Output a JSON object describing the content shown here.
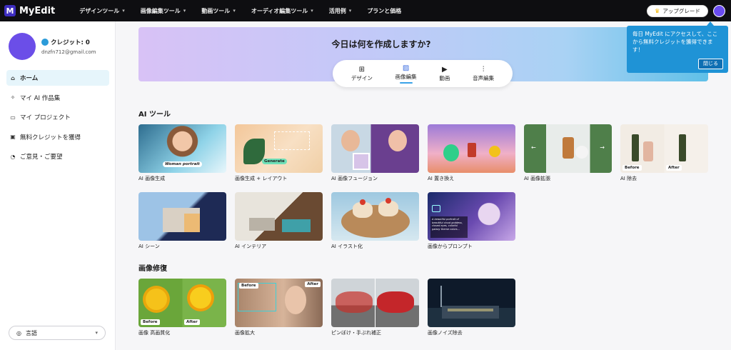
{
  "brand": {
    "name": "MyEdit",
    "logo_letter": "M"
  },
  "nav": [
    {
      "label": "デザインツール"
    },
    {
      "label": "画像編集ツール"
    },
    {
      "label": "動画ツール"
    },
    {
      "label": "オーディオ編集ツール"
    },
    {
      "label": "活用例"
    },
    {
      "label": "プランと価格"
    }
  ],
  "upgrade_label": "アップグレード",
  "profile": {
    "credit": "クレジット: 0",
    "email": "dnzfn712@gmail.com"
  },
  "menu": [
    {
      "label": "ホーム",
      "icon": "home-icon",
      "glyph": "⌂",
      "active": true
    },
    {
      "label": "マイ AI 作品集",
      "icon": "sparkle-icon",
      "glyph": "✧",
      "active": false
    },
    {
      "label": "マイ プロジェクト",
      "icon": "folder-icon",
      "glyph": "▭",
      "active": false
    },
    {
      "label": "無料クレジットを獲得",
      "icon": "gift-icon",
      "glyph": "▣",
      "active": false
    },
    {
      "label": "ご意見・ご要望",
      "icon": "feedback-icon",
      "glyph": "◔",
      "active": false
    }
  ],
  "language": {
    "label": "言語"
  },
  "hero": {
    "title": "今日は何を作成しますか?"
  },
  "create_tabs": [
    {
      "label": "デザイン",
      "icon": "design-icon",
      "glyph": "⊞",
      "active": false
    },
    {
      "label": "画像編集",
      "icon": "image-edit-icon",
      "glyph": "▨",
      "active": true
    },
    {
      "label": "動画",
      "icon": "video-icon",
      "glyph": "▶",
      "active": false
    },
    {
      "label": "音声編集",
      "icon": "audio-wave-icon",
      "glyph": "⫶",
      "active": false
    }
  ],
  "tooltip": {
    "text": "毎日 MyEdit にアクセスして、ここから無料クレジットを獲得できます！",
    "close_label": "閉じる"
  },
  "sections": {
    "ai_tools": {
      "title": "AI ツール",
      "cards": [
        {
          "label": "AI 画像生成",
          "overlay": "Woman portrait"
        },
        {
          "label": "画像生成 + レイアウト",
          "overlay": "Generate"
        },
        {
          "label": "AI 画像フュージョン"
        },
        {
          "label": "AI 置き換え"
        },
        {
          "label": "AI 画像拡張"
        },
        {
          "label": "AI 除去",
          "tag_left": "Before",
          "tag_right": "After"
        },
        {
          "label": "AI シーン"
        },
        {
          "label": "AI インテリア"
        },
        {
          "label": "AI イラスト化"
        },
        {
          "label": "画像からプロンプト",
          "overlay": "A beautiful portrait of beautiful cloud goddess, closed eyes, colorful galaxy theme colors..."
        }
      ]
    },
    "restore": {
      "title": "画像修復",
      "cards": [
        {
          "label": "画像 高画質化",
          "tag_left": "Before",
          "tag_right": "After"
        },
        {
          "label": "画像拡大",
          "tag_left": "Before",
          "tag_right": "After"
        },
        {
          "label": "ピンぼけ・手ぶれ補正"
        },
        {
          "label": "画像ノイズ除去"
        }
      ]
    }
  },
  "colors": {
    "accent": "#1f93d6",
    "nav_bg": "#0e0e11",
    "avatar": "#6b4ee8"
  }
}
